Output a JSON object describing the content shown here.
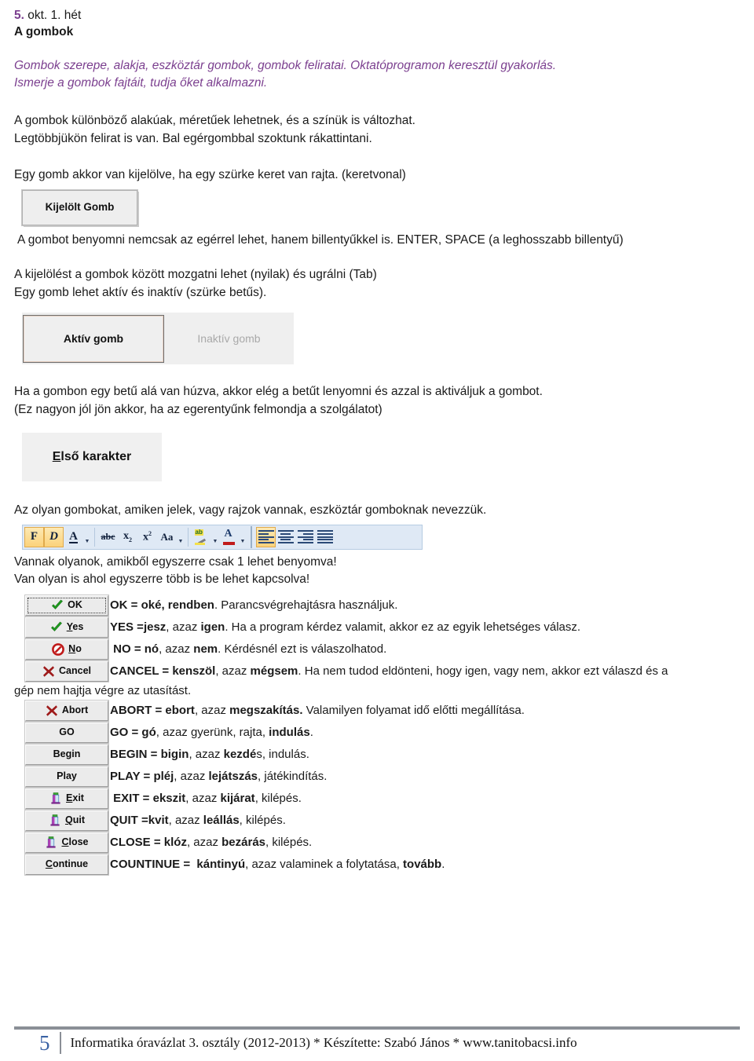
{
  "header": {
    "number": "5.",
    "date_line": " okt. 1. hét",
    "title": "A gombok"
  },
  "aims": {
    "line1": "Gombok szerepe, alakja, eszköztár gombok, gombok feliratai. Oktatóprogramon keresztül gyakorlás.",
    "line2": "Ismerje a gombok fajtáit, tudja őket alkalmazni."
  },
  "intro": {
    "line1": "A gombok különböző alakúak, méretűek lehetnek, és a színük is változhat.",
    "line2": "Legtöbbjükön felirat is van. Bal egérgombbal szoktunk rákattintani."
  },
  "selection": {
    "line1": "Egy gomb akkor van kijelölve, ha egy szürke keret van rajta. (keretvonal)",
    "button_label": "Kijelölt Gomb",
    "line2": "A gombot benyomni nemcsak az egérrel lehet, hanem billentyűkkel is. ENTER, SPACE (a leghosszabb billentyű)"
  },
  "navigation": {
    "line1": "A kijelölést a gombok között mozgatni lehet (nyilak) és ugrálni (Tab)",
    "line2": "Egy gomb lehet aktív és inaktív (szürke betűs).",
    "active_label": "Aktív gomb",
    "inactive_label": "Inaktív gomb"
  },
  "accelerator": {
    "line1": "Ha a gombon egy betű alá van húzva, akkor elég a betűt lenyomni és azzal is aktiváljuk a gombot.",
    "line2": "(Ez nagyon jól jön akkor, ha az egerentyűnk felmondja a szolgálatot)",
    "button_accel": "E",
    "button_rest": "lső karakter"
  },
  "toolbar_section": {
    "intro": "Az olyan gombokat, amiken jelek, vagy rajzok vannak, eszköztár gomboknak nevezzük.",
    "note1": "Vannak olyanok, amikből egyszerre csak 1 lehet benyomva!",
    "note2": "Van olyan is ahol egyszerre több is be lehet kapcsolva!",
    "buttons": [
      {
        "name": "bold-button",
        "glyph": "F",
        "active": true
      },
      {
        "name": "italic-button",
        "glyph": "D",
        "active": true
      },
      {
        "name": "underline-button",
        "glyph": "A",
        "active": false
      },
      {
        "name": "underline-dropdown",
        "glyph": "▾",
        "active": false
      },
      {
        "name": "strikethrough-button",
        "glyph": "abc",
        "active": false
      },
      {
        "name": "subscript-button",
        "glyph": "x₂",
        "active": false
      },
      {
        "name": "superscript-button",
        "glyph": "x²",
        "active": false
      },
      {
        "name": "change-case-button",
        "glyph": "Aa",
        "active": false
      },
      {
        "name": "change-case-dropdown",
        "glyph": "▾",
        "active": false
      },
      {
        "name": "highlight-button",
        "glyph": "ab",
        "active": false
      },
      {
        "name": "highlight-dropdown",
        "glyph": "▾",
        "active": false
      },
      {
        "name": "font-color-button",
        "glyph": "A",
        "active": false
      },
      {
        "name": "font-color-dropdown",
        "glyph": "▾",
        "active": false
      },
      {
        "name": "align-left-button",
        "glyph": "align-left",
        "active": true
      },
      {
        "name": "align-center-button",
        "glyph": "align-center",
        "active": false
      },
      {
        "name": "align-right-button",
        "glyph": "align-right",
        "active": false
      },
      {
        "name": "align-justify-button",
        "glyph": "align-justify",
        "active": false
      }
    ]
  },
  "dialog_buttons": [
    {
      "name": "ok-button",
      "label": "OK",
      "accel": "",
      "icon": "green-check-icon",
      "focused": true,
      "desc_html": "<b>OK = oké, rendben</b>. Parancsvégrehajtásra használjuk.",
      "desc_text": "OK = oké, rendben. Parancsvégrehajtásra használjuk."
    },
    {
      "name": "yes-button",
      "label": "Yes",
      "accel": "Y",
      "icon": "green-check-icon",
      "focused": false,
      "desc_html": "<b>YES =jesz</b>, azaz <b>igen</b>. Ha a program kérdez valamit, akkor ez az egyik lehetséges válasz.",
      "desc_text": "YES =jesz, azaz igen. Ha a program kérdez valamit, akkor ez az egyik lehetséges válasz."
    },
    {
      "name": "no-button",
      "label": "No",
      "accel": "N",
      "icon": "red-no-entry-icon",
      "focused": false,
      "desc_html": "&nbsp;<b>NO = nó</b>, azaz <b>nem</b>. Kérdésnél ezt is válaszolhatod.",
      "desc_text": "NO = nó, azaz nem. Kérdésnél ezt is válaszolhatod."
    },
    {
      "name": "cancel-button",
      "label": "Cancel",
      "accel": "",
      "icon": "red-x-icon",
      "focused": false,
      "desc_html": "<b>CANCEL = kenszöl</b>, azaz <b>mégsem</b>. Ha nem tudod eldönteni, hogy igen, vagy nem, akkor ezt válaszd és a",
      "desc_text": "CANCEL = kenszöl, azaz mégsem. Ha nem tudod eldönteni, hogy igen, vagy nem, akkor ezt válaszd és a"
    },
    {
      "name": "abort-button",
      "label": "Abort",
      "accel": "",
      "icon": "red-x-icon",
      "focused": false,
      "desc_html": "<b>ABORT = ebort</b>, azaz <b>megszakítás.</b> Valamilyen folyamat idő előtti megállítása.",
      "desc_text": "ABORT = ebort, azaz megszakítás. Valamilyen folyamat idő előtti megállítása."
    },
    {
      "name": "go-button",
      "label": "GO",
      "accel": "",
      "icon": "",
      "focused": false,
      "desc_html": "<b>GO = gó</b>, azaz gyerünk, rajta, <b>indulás</b>.",
      "desc_text": "GO = gó, azaz gyerünk, rajta, indulás."
    },
    {
      "name": "begin-button",
      "label": "Begin",
      "accel": "",
      "icon": "",
      "focused": false,
      "desc_html": "<b>BEGIN = bigin</b>, azaz <b>kezdé</b>s, indulás.",
      "desc_text": "BEGIN = bigin, azaz kezdés, indulás."
    },
    {
      "name": "play-button",
      "label": "Play",
      "accel": "",
      "icon": "",
      "focused": false,
      "desc_html": "<b>PLAY = pléj</b>, azaz <b>lejátszás</b>, játékindítás.",
      "desc_text": "PLAY = pléj, azaz lejátszás, játékindítás."
    },
    {
      "name": "exit-button",
      "label": "Exit",
      "accel": "E",
      "icon": "exit-door-icon",
      "focused": false,
      "desc_html": "&nbsp;<b>EXIT = ekszit</b>, azaz <b>kijárat</b>, kilépés.",
      "desc_text": "EXIT = ekszit, azaz kijárat, kilépés."
    },
    {
      "name": "quit-button",
      "label": "Quit",
      "accel": "Q",
      "icon": "exit-door-icon",
      "focused": false,
      "desc_html": "<b>QUIT =kvit</b>, azaz <b>leállás</b>, kilépés.",
      "desc_text": "QUIT =kvit, azaz leállás, kilépés."
    },
    {
      "name": "close-button",
      "label": "Close",
      "accel": "C",
      "icon": "exit-door-icon",
      "focused": false,
      "desc_html": "<b>CLOSE = klóz</b>, azaz <b>bezárás</b>, kilépés.",
      "desc_text": "CLOSE = klóz, azaz bezárás, kilépés."
    },
    {
      "name": "continue-button",
      "label": "Continue",
      "accel": "C",
      "icon": "",
      "focused": false,
      "desc_html": "<b>COUNTINUE = &nbsp;kántinyú</b>, azaz valaminek a folytatása, <b>tovább</b>.",
      "desc_text": "COUNTINUE =  kántinyú, azaz valaminek a folytatása, tovább."
    }
  ],
  "cancel_wrap_line": "gép nem hajtja végre az utasítást.",
  "footer": {
    "page_number": "5",
    "text": "Informatika óravázlat 3. osztály (2012-2013) * Készítette: Szabó János * www.tanitobacsi.info"
  },
  "colors": {
    "accent_purple": "#7b3f8f",
    "footer_blue": "#3a62a4",
    "toolbar_bg": "#dfe9f5",
    "toolbar_active": "#fbd27a",
    "check_green": "#1f9e1f",
    "x_red": "#9e1a1a"
  }
}
